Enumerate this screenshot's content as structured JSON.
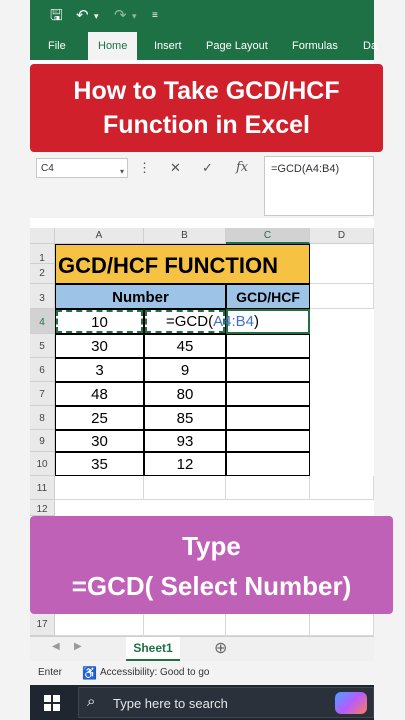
{
  "ribbon": {
    "tabs": [
      "File",
      "Home",
      "Insert",
      "Page Layout",
      "Formulas",
      "Da"
    ],
    "active_tab": "Home"
  },
  "banner": {
    "line1": "How to Take GCD/HCF",
    "line2": "Function in Excel",
    "bg_color": "#d0202b"
  },
  "formula_bar": {
    "name_box": "C4",
    "fx_label": "fx",
    "formula": "=GCD(A4:B4)"
  },
  "grid": {
    "columns": [
      "A",
      "B",
      "C",
      "D"
    ],
    "rows": [
      "1",
      "2",
      "3",
      "4",
      "5",
      "6",
      "7",
      "8",
      "9",
      "10",
      "11",
      "12",
      "17"
    ],
    "title": "GCD/HCF FUNCTION",
    "header_number": "Number",
    "header_result": "GCD/HCF",
    "data": [
      [
        "10",
        ""
      ],
      [
        "30",
        "45"
      ],
      [
        "3",
        "9"
      ],
      [
        "48",
        "80"
      ],
      [
        "25",
        "85"
      ],
      [
        "30",
        "93"
      ],
      [
        "35",
        "12"
      ]
    ],
    "editing": {
      "prefix": "=",
      "func": "GCD(",
      "arg": "A4:B4",
      "suffix": ")"
    }
  },
  "caption": {
    "line1": "Type",
    "line2": "=GCD( Select Number)",
    "bg_color": "#c061b8"
  },
  "sheet_tabs": {
    "active": "Sheet1",
    "add_label": "⊕"
  },
  "status_bar": {
    "mode": "Enter",
    "accessibility": "Accessibility: Good to go"
  },
  "taskbar": {
    "search_placeholder": "Type here to search"
  },
  "colors": {
    "excel_green": "#1e7145",
    "title_fill": "#f6c244",
    "header_fill": "#9dc3e6"
  }
}
